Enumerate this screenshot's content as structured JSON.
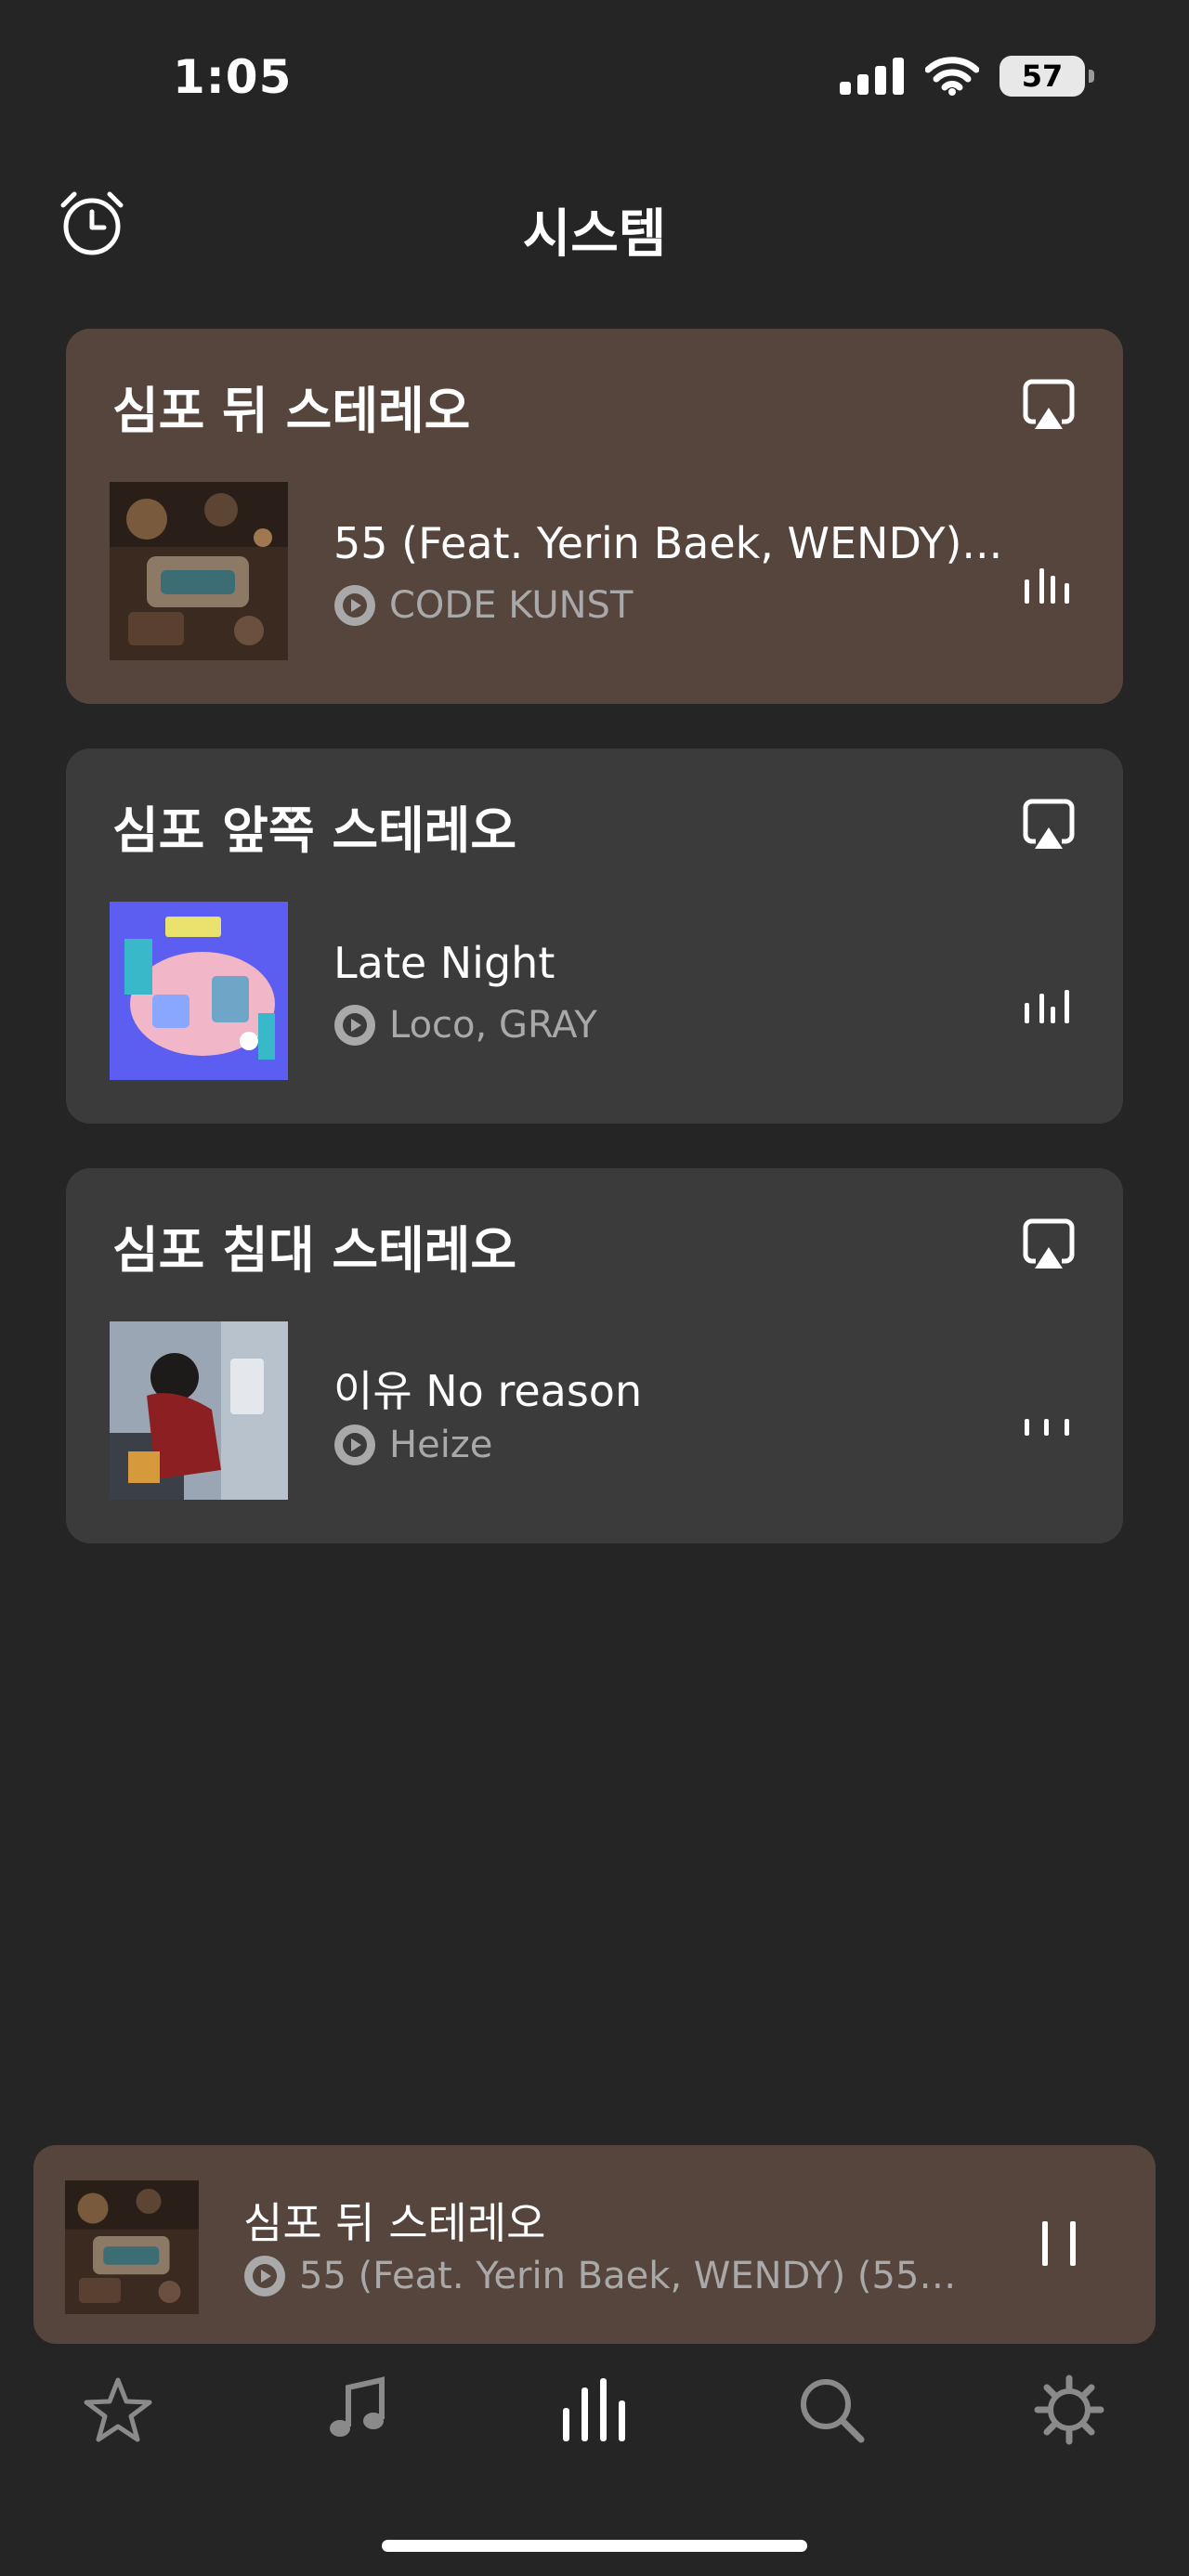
{
  "status_bar": {
    "time": "1:05",
    "battery": "57"
  },
  "header": {
    "title": "시스템"
  },
  "rooms": [
    {
      "name": "심포 뒤 스테레오",
      "track": "55 (Feat. Yerin Baek, WENDY)...",
      "artist": "CODE KUNST",
      "active": true
    },
    {
      "name": "심포 앞쪽 스테레오",
      "track": "Late Night",
      "artist": "Loco, GRAY",
      "active": false
    },
    {
      "name": "심포 침대 스테레오",
      "track": "이유 No reason",
      "artist": "Heize",
      "active": false
    }
  ],
  "mini_player": {
    "room": "심포 뒤 스테레오",
    "track": "55 (Feat. Yerin Baek, WENDY) (55 •..."
  },
  "tabs": [
    {
      "icon": "star-icon",
      "active": false
    },
    {
      "icon": "music-note-icon",
      "active": false
    },
    {
      "icon": "system-bars-icon",
      "active": true
    },
    {
      "icon": "search-icon",
      "active": false
    },
    {
      "icon": "gear-icon",
      "active": false
    }
  ],
  "colors": {
    "background": "#252525",
    "card": "#3b3b3b",
    "active_card": "#56453c",
    "secondary_text": "#a9a9a9",
    "inactive_icon": "#8a8a8a"
  }
}
